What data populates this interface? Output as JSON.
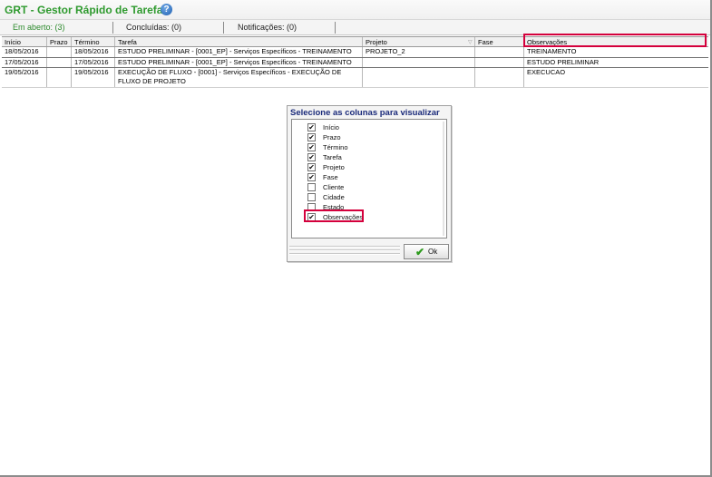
{
  "app": {
    "title": "GRT - Gestor Rápido de Tarefas",
    "help_icon": "help-icon"
  },
  "tabs": [
    {
      "label": "Em aberto: (3)",
      "active": true
    },
    {
      "label": "Concluídas: (0)",
      "active": false
    },
    {
      "label": "Notificações: (0)",
      "active": false
    }
  ],
  "grid": {
    "columns": [
      "Início",
      "Prazo",
      "Término",
      "Tarefa",
      "Projeto",
      "Fase",
      "Observações"
    ],
    "rows": [
      {
        "inicio": "18/05/2016",
        "prazo": "",
        "termino": "18/05/2016",
        "tarefa": "ESTUDO PRELIMINAR - [0001_EP] - Serviços Específicos - TREINAMENTO",
        "projeto": "PROJETO_2",
        "fase": "",
        "observacoes": "TREINAMENTO"
      },
      {
        "inicio": "17/05/2016",
        "prazo": "",
        "termino": "17/05/2016",
        "tarefa": "ESTUDO PRELIMINAR - [0001_EP] - Serviços Específicos - TREINAMENTO",
        "projeto": "",
        "fase": "",
        "observacoes": "ESTUDO PRELIMINAR"
      },
      {
        "inicio": "19/05/2016",
        "prazo": "",
        "termino": "19/05/2016",
        "tarefa": "EXECUÇÃO DE FLUXO - [0001] - Serviços Específicos - EXECUÇÃO DE FLUXO DE PROJETO",
        "projeto": "",
        "fase": "",
        "observacoes": "EXECUCAO"
      }
    ],
    "highlight_color": "#d4003c"
  },
  "dialog": {
    "title": "Selecione as colunas para visualizar",
    "items": [
      {
        "label": "Início",
        "checked": true
      },
      {
        "label": "Prazo",
        "checked": true
      },
      {
        "label": "Término",
        "checked": true
      },
      {
        "label": "Tarefa",
        "checked": true
      },
      {
        "label": "Projeto",
        "checked": true
      },
      {
        "label": "Fase",
        "checked": true
      },
      {
        "label": "Cliente",
        "checked": false
      },
      {
        "label": "Cidade",
        "checked": false
      },
      {
        "label": "Estado",
        "checked": false
      },
      {
        "label": "Observações",
        "checked": true
      }
    ],
    "ok_label": "Ok",
    "ok_icon": "checkmark-icon",
    "check_glyph": "✔"
  }
}
